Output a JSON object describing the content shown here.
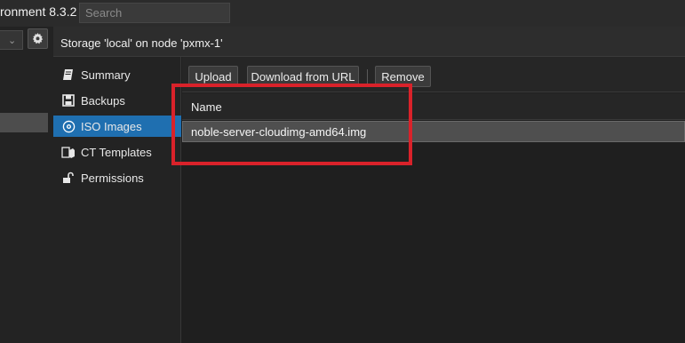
{
  "app": {
    "title_fragment": "ronment 8.3.2"
  },
  "search": {
    "placeholder": "Search"
  },
  "header": {
    "title": "Storage 'local' on node 'pxmx-1'"
  },
  "nav": {
    "items": [
      {
        "label": "Summary",
        "icon": "book-icon"
      },
      {
        "label": "Backups",
        "icon": "floppy-icon"
      },
      {
        "label": "ISO Images",
        "icon": "disc-icon",
        "active": true
      },
      {
        "label": "CT Templates",
        "icon": "template-icon"
      },
      {
        "label": "Permissions",
        "icon": "unlock-icon"
      }
    ]
  },
  "toolbar": {
    "upload_label": "Upload",
    "download_label": "Download from URL",
    "remove_label": "Remove"
  },
  "grid": {
    "column_name": "Name",
    "rows": [
      {
        "name": "noble-server-cloudimg-amd64.img"
      }
    ]
  },
  "colors": {
    "accent": "#1f6fb0",
    "highlight": "#d9222a",
    "selected_row": "#4f4f4f"
  }
}
